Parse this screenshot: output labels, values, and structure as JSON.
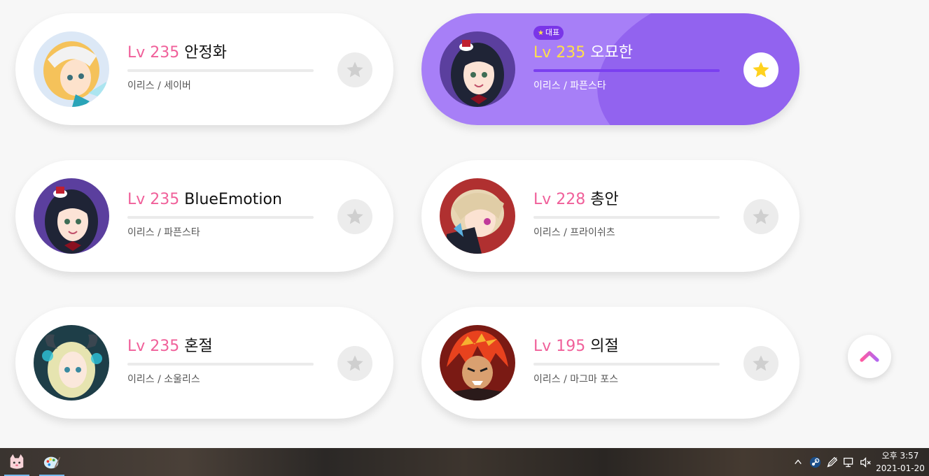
{
  "characters": [
    {
      "level_label": "Lv 235",
      "name": "안정화",
      "info": "이리스 / 세이버",
      "avatar_icon": "blonde-maid-avatar",
      "favorite": false
    },
    {
      "level_label": "Lv 235",
      "name": "오묘한",
      "info": "이리스 / 파픈스타",
      "avatar_icon": "dark-hair-girl-avatar",
      "favorite": true,
      "badge": "대표"
    },
    {
      "level_label": "Lv 235",
      "name": "BlueEmotion",
      "info": "이리스 / 파픈스타",
      "avatar_icon": "dark-hair-girl-avatar",
      "favorite": false
    },
    {
      "level_label": "Lv 228",
      "name": "총안",
      "info": "이리스 / 프라이쉬츠",
      "avatar_icon": "gunner-avatar",
      "favorite": false
    },
    {
      "level_label": "Lv 235",
      "name": "혼절",
      "info": "이리스 / 소울리스",
      "avatar_icon": "horned-girl-avatar",
      "favorite": false
    },
    {
      "level_label": "Lv 195",
      "name": "의절",
      "info": "이리스 / 마그마 포스",
      "avatar_icon": "fire-warrior-avatar",
      "favorite": false
    }
  ],
  "scroll_top_icon": "chevron-up-icon",
  "taskbar": {
    "apps": [
      "cat-app-icon",
      "paint-app-icon"
    ],
    "tray_icons": [
      "chevron-up-icon",
      "steam-icon",
      "pen-icon",
      "network-icon",
      "volume-muted-icon"
    ],
    "clock_time": "오후 3:57",
    "clock_date": "2021-01-20"
  },
  "colors": {
    "level": "#f0609a",
    "main_level": "#ffe04a",
    "main_card": "#a77ff7",
    "star_active": "#ffd21e",
    "star_inactive": "#cfcfcf"
  }
}
